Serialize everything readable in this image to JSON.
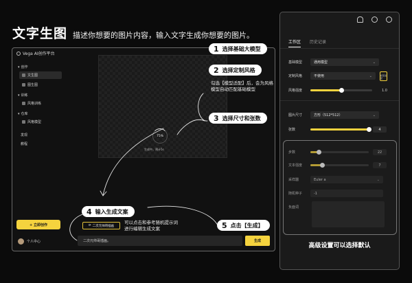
{
  "headline": {
    "title": "文字生图",
    "subtitle": "描述你想要的图片内容，输入文字生成你想要的图片。"
  },
  "app": {
    "title": "Vega AI创作平台",
    "sidebar": {
      "group_create": "创作",
      "item_text2img": "文生图",
      "item_img2img": "图生图",
      "group_train": "训练",
      "item_style_train": "风格训练",
      "group_repo": "仓库",
      "item_style_model": "风格模型",
      "discover": "发现",
      "tutorial": "教程",
      "create_button": "+ 立即创作",
      "user": "个人中心"
    },
    "progress": {
      "percent": "75%",
      "status": "生成中，预计5s"
    },
    "prompt_chip": "二次元帅哥插画",
    "prompt_value": "二次元帅哥插画。",
    "generate_button": "生成"
  },
  "callouts": {
    "step1": {
      "num": "1",
      "text": "选择基础大模型"
    },
    "step2": {
      "num": "2",
      "text": "选择定制风格"
    },
    "step2_note_line1": "勾选【模型适配】后，会为风格",
    "step2_note_line2": "模型自动匹配基础模型",
    "step3": {
      "num": "3",
      "text": "选择尺寸和张数"
    },
    "step4": {
      "num": "4",
      "text": "输入生成文案"
    },
    "step4_note_line1": "可以点击和参考随机提示词",
    "step4_note_line2": "进行编辑生成文案",
    "step5": {
      "num": "5",
      "text": "点击【生成】"
    }
  },
  "panel": {
    "tabs": [
      "工作区",
      "历史记录"
    ],
    "base_model": {
      "label": "基础模型",
      "value": "通用模型"
    },
    "style": {
      "label": "定制风格",
      "value": "不使用",
      "adapt": "模型适配"
    },
    "style_strength": {
      "label": "风格强度",
      "value": "1.0",
      "fraction": 0.5
    },
    "image_size": {
      "label": "图片尺寸",
      "value": "方形（512*512）"
    },
    "count": {
      "label": "张数",
      "value": "4",
      "fraction": 1.0
    },
    "steps": {
      "label": "步数",
      "value": "22",
      "fraction": 0.15
    },
    "text_strength": {
      "label": "文本强度",
      "value": "7",
      "fraction": 0.2
    },
    "sampler": {
      "label": "采样器",
      "value": "Euler a"
    },
    "seed": {
      "label": "随机种子",
      "value": "-1"
    },
    "negative": {
      "label": "负面词"
    },
    "caption": "高级设置可以选择默认"
  },
  "colors": {
    "accent": "#f5d33e",
    "background": "#0b0b0b"
  }
}
